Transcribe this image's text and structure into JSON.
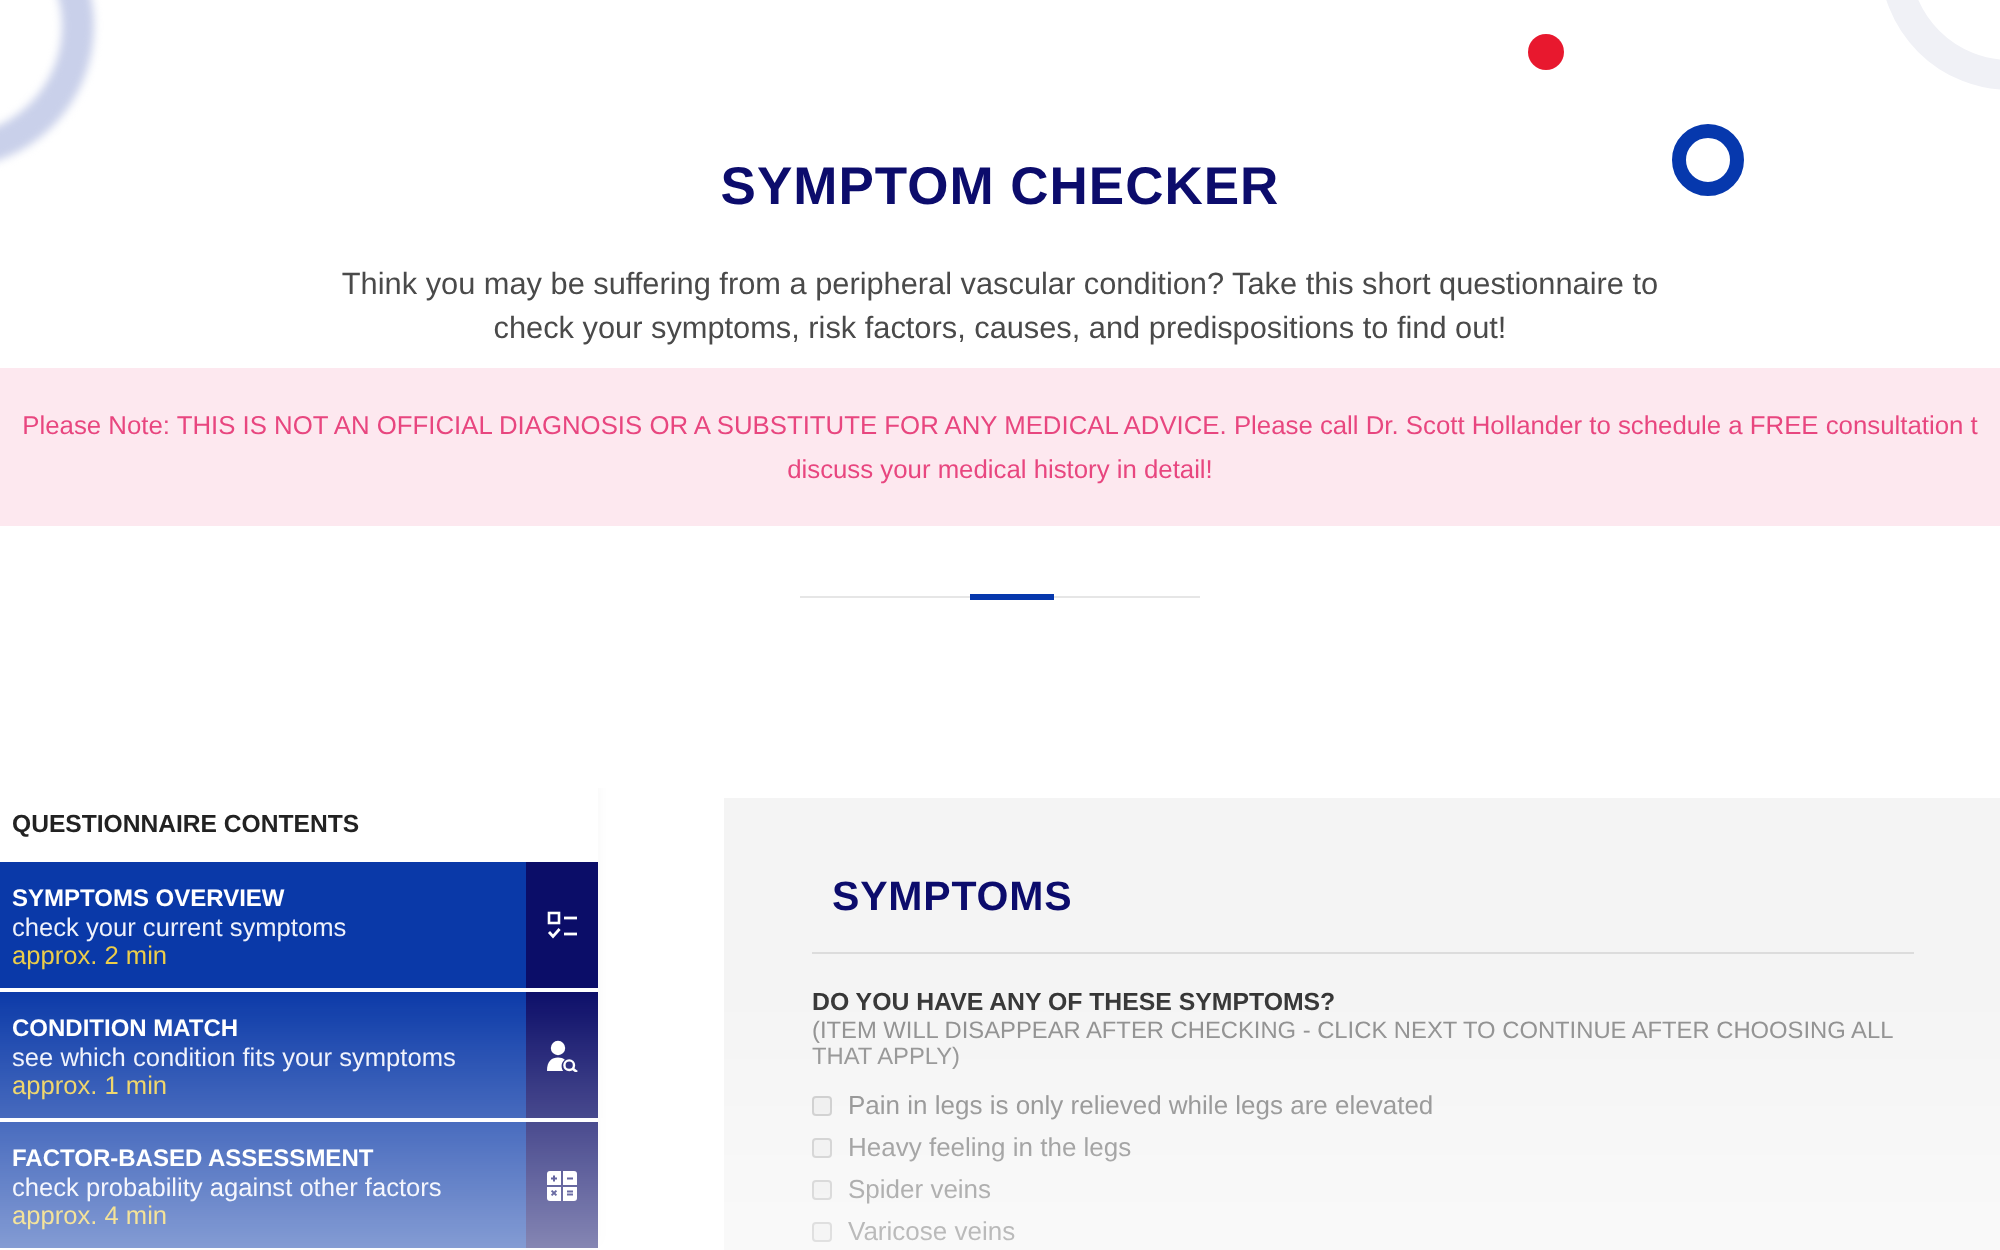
{
  "header": {
    "title": "SYMPTOM CHECKER",
    "intro": "Think you may be suffering from a peripheral vascular condition? Take this short questionnaire to check your symptoms, risk factors, causes, and predispositions to find out!"
  },
  "notice": {
    "lines": [
      "Please Note: THIS IS NOT AN OFFICIAL DIAGNOSIS OR A SUBSTITUTE FOR ANY MEDICAL ADVICE. Please call Dr. Scott Hollander to schedule a FREE consultation t",
      "discuss your medical history in detail!"
    ]
  },
  "sidebar": {
    "title": "QUESTIONNAIRE CONTENTS",
    "items": [
      {
        "kind": "checklist",
        "title": "SYMPTOMS OVERVIEW",
        "description": "check your current symptoms",
        "duration": "approx. 2 min"
      },
      {
        "kind": "match",
        "title": "CONDITION MATCH",
        "description": "see which condition fits your symptoms",
        "duration": "approx. 1 min"
      },
      {
        "kind": "calculator",
        "title": "FACTOR-BASED ASSESSMENT",
        "description": "check probability against other factors",
        "duration": "approx. 4 min"
      }
    ]
  },
  "panel": {
    "title": "SYMPTOMS",
    "question": "DO YOU HAVE ANY OF THESE SYMPTOMS?",
    "hint": "(ITEM WILL DISAPPEAR AFTER CHECKING - CLICK NEXT TO CONTINUE AFTER CHOOSING ALL THAT APPLY)",
    "symptoms": [
      {
        "label": "Pain in legs is only relieved while legs are elevated",
        "checked": false
      },
      {
        "label": "Heavy feeling in the legs",
        "checked": false
      },
      {
        "label": "Spider veins",
        "checked": false
      },
      {
        "label": "Varicose veins",
        "checked": false
      }
    ]
  }
}
